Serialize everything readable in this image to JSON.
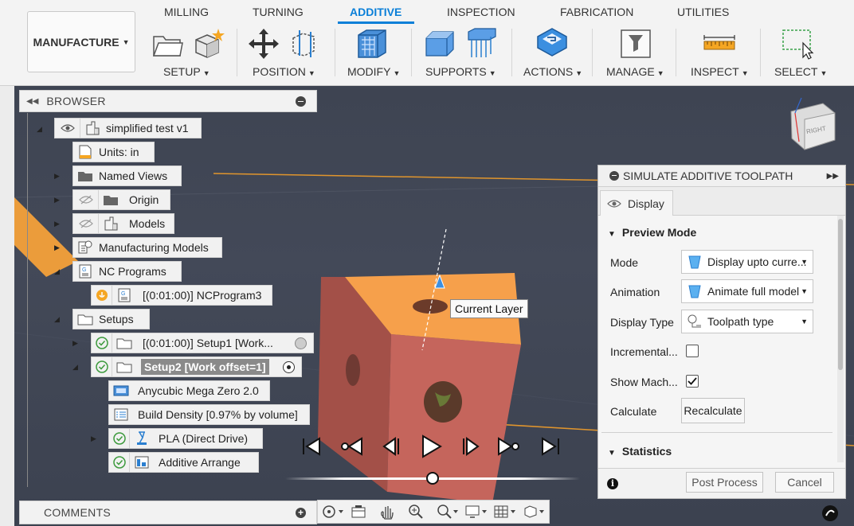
{
  "toolbar": {
    "workspace_label": "MANUFACTURE",
    "tabs": [
      {
        "label": "MILLING",
        "active": false
      },
      {
        "label": "TURNING",
        "active": false
      },
      {
        "label": "ADDITIVE",
        "active": true
      },
      {
        "label": "INSPECTION",
        "active": false
      },
      {
        "label": "FABRICATION",
        "active": false
      },
      {
        "label": "UTILITIES",
        "active": false
      }
    ],
    "groups": [
      {
        "label": "SETUP",
        "icon": "setup-icon"
      },
      {
        "label": "POSITION",
        "icon": "move-icon"
      },
      {
        "label": "MODIFY",
        "icon": "modify-icon"
      },
      {
        "label": "SUPPORTS",
        "icon": "supports-icon"
      },
      {
        "label": "ACTIONS",
        "icon": "actions-icon"
      },
      {
        "label": "MANAGE",
        "icon": "manage-icon"
      },
      {
        "label": "INSPECT",
        "icon": "ruler-icon"
      },
      {
        "label": "SELECT",
        "icon": "select-icon"
      }
    ]
  },
  "browser": {
    "title": "BROWSER",
    "items": [
      {
        "label": "simplified test v1",
        "icon": "document-icon"
      },
      {
        "label": "Units: in",
        "icon": "units-icon"
      },
      {
        "label": "Named Views",
        "icon": "folder-icon"
      },
      {
        "label": "Origin",
        "icon": "folder-icon"
      },
      {
        "label": "Models",
        "icon": "models-icon"
      },
      {
        "label": "Manufacturing Models",
        "icon": "mfg-model-icon"
      },
      {
        "label": "NC Programs",
        "icon": "nc-program-icon"
      },
      {
        "label": "[(0:01:00)] NCProgram3",
        "icon": "nc-program-icon"
      },
      {
        "label": "Setups",
        "icon": "folder-icon"
      },
      {
        "label": "[(0:01:00)] Setup1 [Work...",
        "icon": "folder-icon"
      },
      {
        "label": "Setup2 [Work offset=1]",
        "icon": "folder-icon"
      },
      {
        "label": "Anycubic Mega Zero 2.0",
        "icon": "printer-icon"
      },
      {
        "label": "Build Density [0.97% by volume]",
        "icon": "density-icon"
      },
      {
        "label": "PLA (Direct Drive)",
        "icon": "material-icon"
      },
      {
        "label": "Additive Arrange",
        "icon": "arrange-icon"
      }
    ]
  },
  "comments": {
    "title": "COMMENTS"
  },
  "viewcube": {
    "face": "RIGHT"
  },
  "tooltip": {
    "text": "Current Layer"
  },
  "simulate": {
    "title": "SIMULATE ADDITIVE TOOLPATH",
    "tab_label": "Display",
    "preview_title": "Preview Mode",
    "mode_label": "Mode",
    "mode_value": "Display upto curre...",
    "animation_label": "Animation",
    "animation_value": "Animate full model",
    "display_type_label": "Display Type",
    "display_type_value": "Toolpath type",
    "incremental_label": "Incremental...",
    "incremental_checked": false,
    "show_machine_label": "Show Mach...",
    "show_machine_checked": true,
    "calculate_label": "Calculate",
    "recalculate_label": "Recalculate",
    "statistics_title": "Statistics",
    "post_process_label": "Post Process",
    "cancel_label": "Cancel"
  },
  "colors": {
    "accent": "#0a7fd8",
    "model_side": "#b65a52",
    "model_top": "#f6a04b",
    "check_green": "#3c9a3c",
    "build_path": "#f4a13a"
  },
  "playback": {
    "progress": 0.5
  }
}
